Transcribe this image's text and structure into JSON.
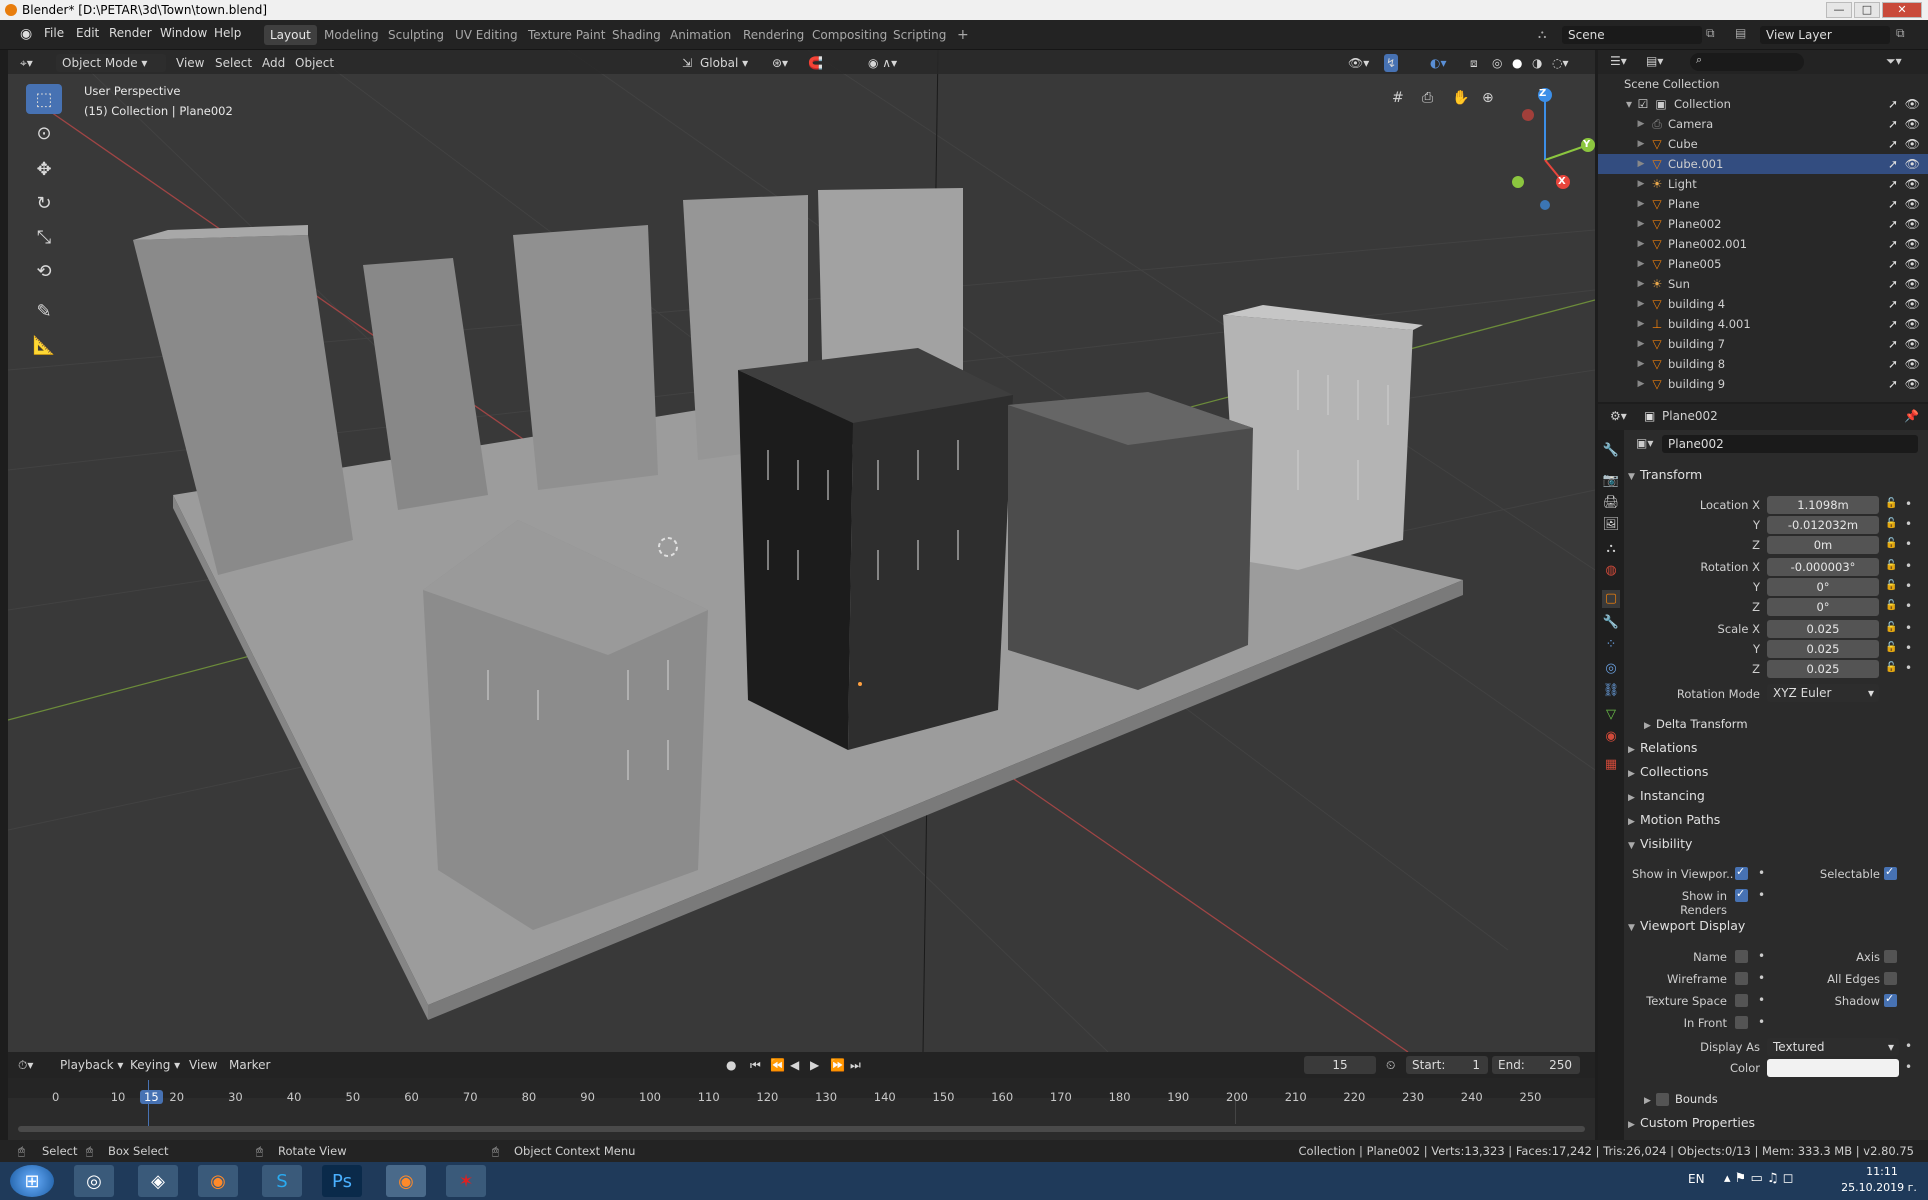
{
  "window": {
    "title": "Blender* [D:\\PETAR\\3d\\Town\\town.blend]",
    "minimize": "—",
    "maximize": "□",
    "close": "✕"
  },
  "menu": [
    "File",
    "Edit",
    "Render",
    "Window",
    "Help"
  ],
  "workspaces": [
    "Layout",
    "Modeling",
    "Sculpting",
    "UV Editing",
    "Texture Paint",
    "Shading",
    "Animation",
    "Rendering",
    "Compositing",
    "Scripting"
  ],
  "active_workspace": "Layout",
  "add_workspace": "+",
  "scene": {
    "name": "Scene",
    "view_layer": "View Layer"
  },
  "viewport_header": {
    "mode": "Object Mode",
    "view": "View",
    "select": "Select",
    "add": "Add",
    "object": "Object",
    "orientation": "Global"
  },
  "viewport": {
    "perspective": "User Perspective",
    "collection_info": "(15) Collection | Plane002"
  },
  "gizmo": {
    "x": "X",
    "y": "Y",
    "z": "Z"
  },
  "outliner": {
    "root": "Scene Collection",
    "collection": "Collection",
    "items": [
      {
        "name": "Camera",
        "icon": "camera-icon"
      },
      {
        "name": "Cube",
        "icon": "mesh-icon"
      },
      {
        "name": "Cube.001",
        "icon": "mesh-icon",
        "selected": true
      },
      {
        "name": "Light",
        "icon": "light-icon"
      },
      {
        "name": "Plane",
        "icon": "mesh-icon"
      },
      {
        "name": "Plane002",
        "icon": "mesh-icon"
      },
      {
        "name": "Plane002.001",
        "icon": "mesh-icon"
      },
      {
        "name": "Plane005",
        "icon": "mesh-icon"
      },
      {
        "name": "Sun",
        "icon": "light-icon"
      },
      {
        "name": "building 4",
        "icon": "mesh-icon"
      },
      {
        "name": "building 4.001",
        "icon": "empty-icon"
      },
      {
        "name": "building 7",
        "icon": "mesh-icon"
      },
      {
        "name": "building 8",
        "icon": "mesh-icon"
      },
      {
        "name": "building 9",
        "icon": "mesh-icon"
      }
    ]
  },
  "properties": {
    "header_object": "Plane002",
    "object_name": "Plane002",
    "transform_title": "Transform",
    "location": {
      "label_x": "Location X",
      "x": "1.1098m",
      "y": "-0.012032m",
      "z": "0m"
    },
    "rotation": {
      "label_x": "Rotation X",
      "x": "-0.000003°",
      "y": "0°",
      "z": "0°"
    },
    "scale": {
      "label_x": "Scale X",
      "x": "0.025",
      "y": "0.025",
      "z": "0.025"
    },
    "axis_y": "Y",
    "axis_z": "Z",
    "rotation_mode_label": "Rotation Mode",
    "rotation_mode": "XYZ Euler",
    "delta_transform": "Delta Transform",
    "sections": [
      "Relations",
      "Collections",
      "Instancing",
      "Motion Paths"
    ],
    "visibility": "Visibility",
    "show_in_viewport": "Show in Viewpor..",
    "selectable": "Selectable",
    "show_in_renders": "Show in Renders",
    "viewport_display": "Viewport Display",
    "vd_name": "Name",
    "vd_axis": "Axis",
    "vd_wireframe": "Wireframe",
    "vd_all_edges": "All Edges",
    "vd_texture_space": "Texture Space",
    "vd_shadow": "Shadow",
    "vd_in_front": "In Front",
    "display_as_label": "Display As",
    "display_as": "Textured",
    "color_label": "Color",
    "bounds": "Bounds",
    "custom_properties": "Custom Properties"
  },
  "timeline": {
    "playback": "Playback",
    "keying": "Keying",
    "view": "View",
    "marker": "Marker",
    "current_frame": "15",
    "start_label": "Start:",
    "start": "1",
    "end_label": "End:",
    "end": "250",
    "ticks": [
      "0",
      "10",
      "15",
      "20",
      "30",
      "40",
      "50",
      "60",
      "70",
      "80",
      "90",
      "100",
      "110",
      "120",
      "130",
      "140",
      "150",
      "160",
      "170",
      "180",
      "190",
      "200",
      "210",
      "220",
      "230",
      "240",
      "250"
    ]
  },
  "status": {
    "select": "Select",
    "box_select": "Box Select",
    "rotate_view": "Rotate View",
    "context_menu": "Object Context Menu",
    "stats": "Collection | Plane002 | Verts:13,323 | Faces:17,242 | Tris:26,024 | Objects:0/13 | Mem: 333.3 MB | v2.80.75"
  },
  "taskbar": {
    "lang": "EN",
    "time": "11:11",
    "date": "25.10.2019 г."
  },
  "colors": {
    "accent": "#4772b3",
    "selection": "#334d80",
    "x_axis": "#e8453c",
    "y_axis": "#8cc63f",
    "z_axis": "#3c8fe8"
  }
}
